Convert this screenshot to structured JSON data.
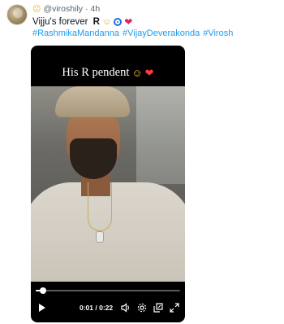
{
  "post": {
    "username": "@viroshily",
    "separator": "·",
    "age": "4h",
    "text_prefix": "Vijju's forever ",
    "text_bold": "R",
    "hashtags": [
      "#RashmikaMandanna",
      "#VijayDeverakonda",
      "#Virosh"
    ]
  },
  "video": {
    "caption": "His R pendent",
    "time": "0:01 / 0:22",
    "progress": 0.05,
    "icons": [
      "play-icon",
      "volume-icon",
      "settings-icon",
      "picture-in-picture-icon",
      "fullscreen-icon"
    ]
  },
  "colors": {
    "link": "#1d9bf0",
    "meta": "#536471",
    "video_bg": "#000000"
  }
}
